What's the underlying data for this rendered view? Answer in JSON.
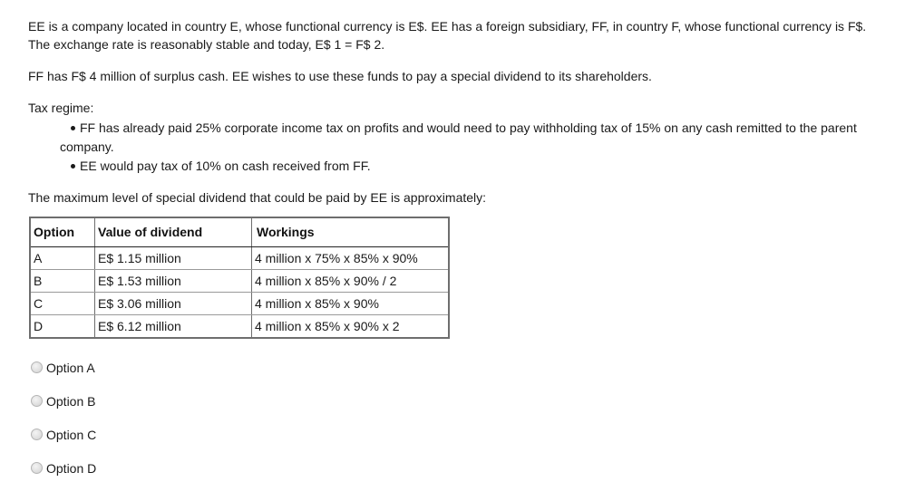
{
  "question": {
    "intro_line1": "EE is a company located in country E, whose functional currency is E$. EE has a foreign subsidiary, FF, in country F, whose functional currency is F$.",
    "intro_line2": "The exchange rate is reasonably stable and today, E$ 1 = F$ 2.",
    "surplus": "FF has F$ 4 million of surplus cash. EE wishes to use these funds to pay a special dividend to its shareholders.",
    "tax_label": "Tax regime:",
    "tax_bullets": [
      "FF has already paid 25% corporate income tax on profits and would need to pay withholding tax of 15% on any cash remitted to the parent",
      "EE would pay tax of 10% on cash received from FF."
    ],
    "tax_bullet_1_wrap": "company.",
    "prompt": "The maximum level of special dividend that could be paid by EE is approximately:"
  },
  "table": {
    "headers": [
      "Option",
      "Value of dividend",
      "Workings"
    ],
    "rows": [
      {
        "option": "A",
        "value": "E$ 1.15 million",
        "workings": "4 million x 75% x 85% x 90%"
      },
      {
        "option": "B",
        "value": "E$ 1.53 million",
        "workings": "4 million x 85% x 90% / 2"
      },
      {
        "option": "C",
        "value": "E$ 3.06 million",
        "workings": "4 million x 85% x 90%"
      },
      {
        "option": "D",
        "value": "E$ 6.12 million",
        "workings": "4 million x 85% x 90% x 2"
      }
    ]
  },
  "answers": [
    {
      "label": "Option A",
      "selected": false
    },
    {
      "label": "Option B",
      "selected": false
    },
    {
      "label": "Option C",
      "selected": false
    },
    {
      "label": "Option D",
      "selected": false
    }
  ]
}
